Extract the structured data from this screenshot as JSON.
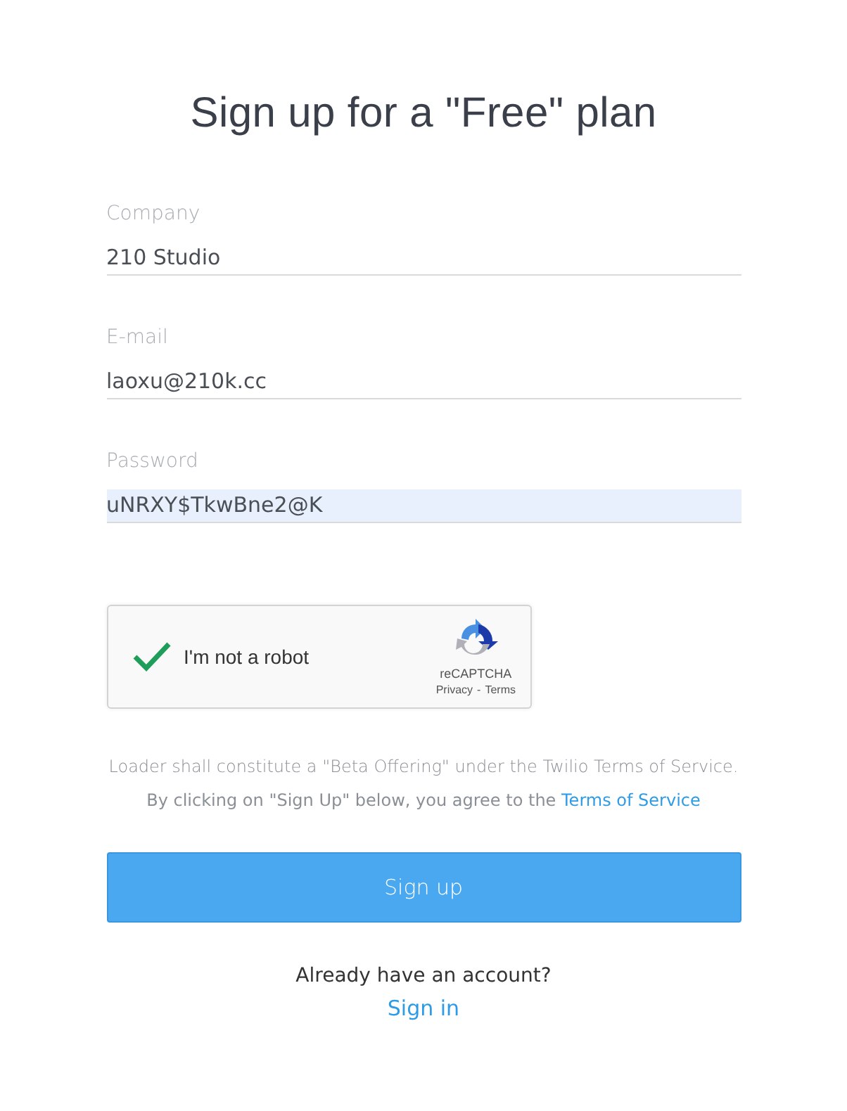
{
  "title": "Sign up for a \"Free\" plan",
  "fields": [
    {
      "label": "Company",
      "value": "210 Studio",
      "autofilled": false
    },
    {
      "label": "E-mail",
      "value": "laoxu@210k.cc",
      "autofilled": false
    },
    {
      "label": "Password",
      "value": "uNRXY$TkwBne2@K",
      "autofilled": true
    }
  ],
  "captcha": {
    "label": "I'm not a robot",
    "checked": true,
    "brand": "reCAPTCHA",
    "privacy": "Privacy",
    "separator": "-",
    "terms": "Terms"
  },
  "notice": "Loader shall constitute a \"Beta Offering\" under the Twilio Terms of Service.",
  "agreement": {
    "text": "By clicking on \"Sign Up\" below, you agree to the",
    "link": "Terms of Service"
  },
  "submit": "Sign up",
  "footer": {
    "question": "Already have an account?",
    "link": "Sign in"
  }
}
